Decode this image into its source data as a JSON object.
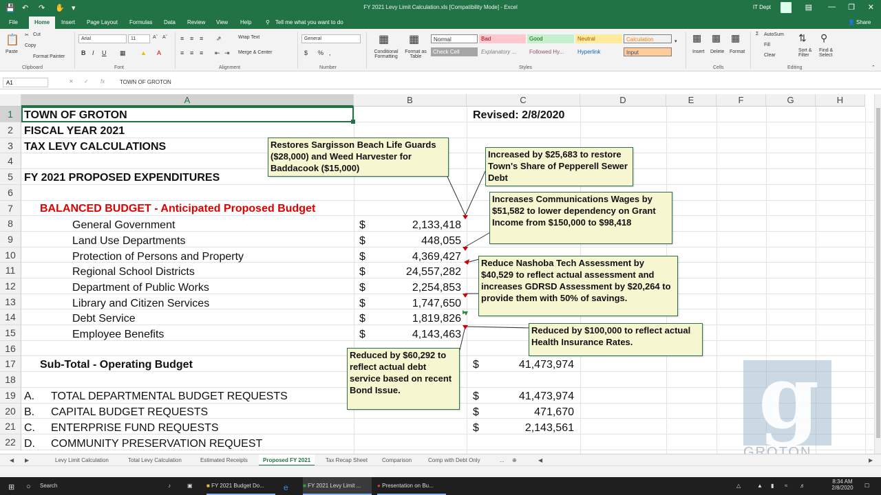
{
  "window": {
    "title": "FY 2021 Levy Limit Calculation.xls  [Compatibility Mode]  -  Excel",
    "user": "IT Dept"
  },
  "ribbon": {
    "tabs": [
      "File",
      "Home",
      "Insert",
      "Page Layout",
      "Formulas",
      "Data",
      "Review",
      "View",
      "Help",
      "Tell me what you want to do"
    ],
    "active_tab": "Home",
    "share": "Share",
    "clipboard": {
      "paste": "Paste",
      "cut": "Cut",
      "copy": "Copy",
      "format_painter": "Format Painter",
      "group": "Clipboard"
    },
    "font": {
      "name": "Arial",
      "size": "11",
      "group": "Font"
    },
    "alignment": {
      "wrap": "Wrap Text",
      "merge": "Merge & Center",
      "group": "Alignment"
    },
    "number": {
      "format": "General",
      "group": "Number"
    },
    "styles_group": "Styles",
    "cond_format": "Conditional Formatting",
    "format_table": "Format as Table",
    "styles": [
      {
        "label": "Normal",
        "bg": "#ffffff",
        "fg": "#000000"
      },
      {
        "label": "Bad",
        "bg": "#ffc7ce",
        "fg": "#9c0006"
      },
      {
        "label": "Good",
        "bg": "#c6efce",
        "fg": "#006100"
      },
      {
        "label": "Neutral",
        "bg": "#ffeb9c",
        "fg": "#9c5700"
      },
      {
        "label": "Calculation",
        "bg": "#f2f2f2",
        "fg": "#fa7d00"
      },
      {
        "label": "Check Cell",
        "bg": "#a5a5a5",
        "fg": "#ffffff"
      },
      {
        "label": "Explanatory ...",
        "bg": "#f3f3f3",
        "fg": "#7f7f7f"
      },
      {
        "label": "Followed Hy...",
        "bg": "#f3f3f3",
        "fg": "#954f72"
      },
      {
        "label": "Hyperlink",
        "bg": "#f3f3f3",
        "fg": "#0563c1"
      },
      {
        "label": "Input",
        "bg": "#ffcc99",
        "fg": "#3f3f76"
      }
    ],
    "cells_group": "Cells",
    "insert": "Insert",
    "delete": "Delete",
    "format": "Format",
    "editing_group": "Editing",
    "autosum": "AutoSum",
    "fill": "Fill",
    "clear": "Clear",
    "sort": "Sort & Filter",
    "find": "Find & Select"
  },
  "formula_bar": {
    "name_box": "A1",
    "content": "TOWN OF GROTON"
  },
  "columns": [
    "A",
    "B",
    "C",
    "D",
    "E",
    "F",
    "G",
    "H"
  ],
  "rows": [
    "1",
    "2",
    "3",
    "4",
    "5",
    "6",
    "7",
    "8",
    "9",
    "10",
    "11",
    "12",
    "13",
    "14",
    "15",
    "16",
    "17",
    "18",
    "19",
    "20",
    "21",
    "22"
  ],
  "sheet": {
    "r1": "TOWN OF GROTON",
    "revised": "Revised:  2/8/2020",
    "r2": "FISCAL YEAR 2021",
    "r3": "TAX LEVY CALCULATIONS",
    "r5": "FY 2021 PROPOSED EXPENDITURES",
    "r7": "BALANCED BUDGET - Anticipated Proposed Budget",
    "currency": "$",
    "items": [
      {
        "label": "General Government",
        "value": "2,133,418"
      },
      {
        "label": "Land Use Departments",
        "value": "448,055"
      },
      {
        "label": "Protection of Persons and Property",
        "value": "4,369,427"
      },
      {
        "label": "Regional School Districts",
        "value": "24,557,282"
      },
      {
        "label": "Department of Public Works",
        "value": "2,254,853"
      },
      {
        "label": "Library and Citizen Services",
        "value": "1,747,650"
      },
      {
        "label": "Debt Service",
        "value": "1,819,826"
      },
      {
        "label": "Employee Benefits",
        "value": "4,143,463"
      }
    ],
    "subtotal_label": "Sub-Total - Operating Budget",
    "subtotal_value": "41,473,974",
    "requests": [
      {
        "letter": "A.",
        "label": "TOTAL DEPARTMENTAL BUDGET REQUESTS",
        "value": "41,473,974"
      },
      {
        "letter": "B.",
        "label": "CAPITAL BUDGET REQUESTS",
        "value": "471,670"
      },
      {
        "letter": "C.",
        "label": "ENTERPRISE FUND REQUESTS",
        "value": "2,143,561"
      },
      {
        "letter": "D.",
        "label": "COMMUNITY PRESERVATION REQUEST",
        "value": ""
      }
    ]
  },
  "comments": {
    "c1": "Restores Sargisson Beach Life Guards ($28,000) and Weed Harvester for Baddacook ($15,000)",
    "c2": "Increased by $25,683 to restore Town's Share of Pepperell Sewer Debt",
    "c3": "Increases Communications Wages by $51,582 to lower dependency on Grant Income from $150,000 to $98,418",
    "c4": "Reduce Nashoba Tech Assessment by $40,529 to reflect actual assessment and increases GDRSD Assessment by $20,264 to provide them with 50% of savings.",
    "c5": "Reduced by $100,000 to reflect actual Health Insurance Rates.",
    "c6": "Reduced by $60,292 to reflect actual debt service based on recent Bond Issue."
  },
  "sheet_tabs": [
    "Levy Limit Calculation",
    "Total Levy Calculation",
    "Estimated Receipts",
    "Proposed FY 2021",
    "Tax Recap Sheet",
    "Comparison",
    "Comp with Debt Only",
    "..."
  ],
  "active_sheet": "Proposed FY 2021",
  "watermark": "GROTON",
  "taskbar": {
    "search": "Search",
    "apps": [
      "FY 2021 Budget Do...",
      "FY 2021 Levy Limit ...",
      "Presentation on Bu..."
    ],
    "time": "8:34 AM",
    "date": "2/8/2020"
  }
}
